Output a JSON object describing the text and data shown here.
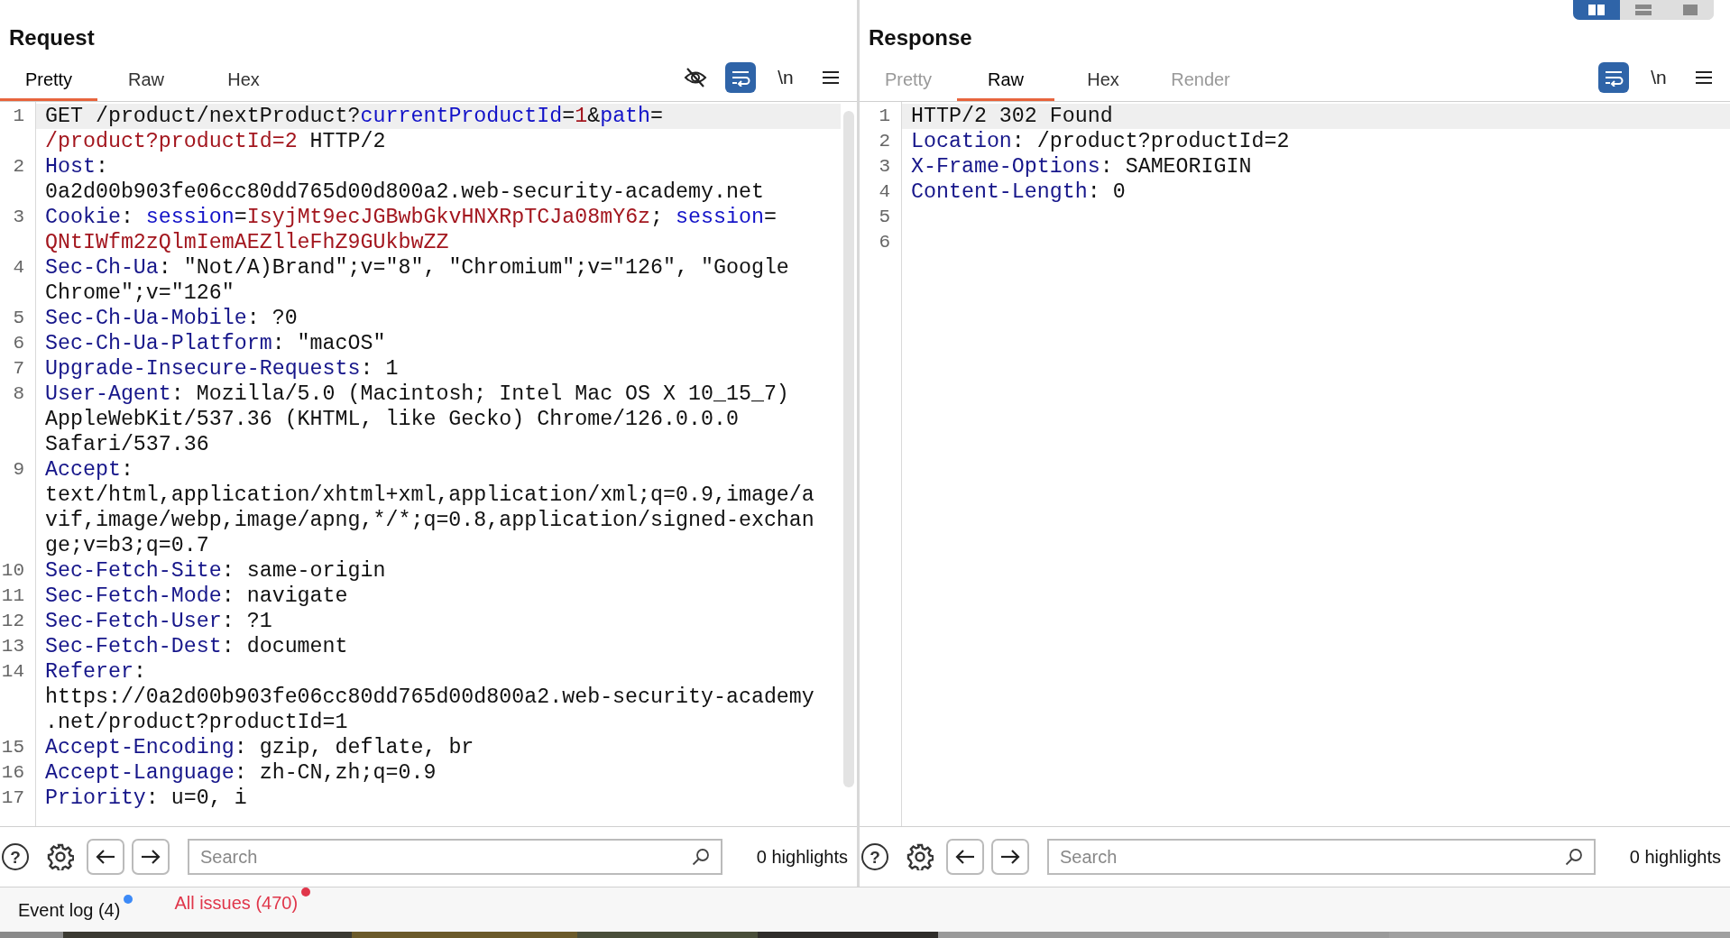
{
  "layout_toggle": [
    {
      "selected": true
    },
    {
      "selected": false
    },
    {
      "selected": false
    }
  ],
  "panes": [
    {
      "title": "Request",
      "tabs": [
        {
          "label": "Pretty",
          "selected": true,
          "disabled": false
        },
        {
          "label": "Raw",
          "selected": false,
          "disabled": false
        },
        {
          "label": "Hex",
          "selected": false,
          "disabled": false
        }
      ],
      "toolbar": [
        {
          "kind": "hide",
          "on": false
        },
        {
          "kind": "wrap",
          "on": true
        },
        {
          "kind": "newline",
          "label": "\\n",
          "on": false
        },
        {
          "kind": "menu",
          "on": false
        }
      ],
      "lines": [
        {
          "number": "1",
          "current": true,
          "rows": [
            [
              {
                "kind": "plain",
                "text": "GET /product/nextProduct?"
              },
              {
                "kind": "param",
                "text": "currentProductId"
              },
              {
                "kind": "plain",
                "text": "="
              },
              {
                "kind": "value",
                "text": "1"
              },
              {
                "kind": "plain",
                "text": "&"
              },
              {
                "kind": "param",
                "text": "path"
              },
              {
                "kind": "plain",
                "text": "="
              }
            ],
            [
              {
                "kind": "value",
                "text": "/product?productId=2"
              },
              {
                "kind": "plain",
                "text": " HTTP/2"
              }
            ]
          ]
        },
        {
          "number": "2",
          "current": false,
          "rows": [
            [
              {
                "kind": "name",
                "text": "Host"
              },
              {
                "kind": "plain",
                "text": ":"
              }
            ],
            [
              {
                "kind": "plain",
                "text": "0a2d00b903fe06cc80dd765d00d800a2.web-security-academy.net"
              }
            ]
          ]
        },
        {
          "number": "3",
          "current": false,
          "rows": [
            [
              {
                "kind": "name",
                "text": "Cookie"
              },
              {
                "kind": "plain",
                "text": ": "
              },
              {
                "kind": "param",
                "text": "session"
              },
              {
                "kind": "plain",
                "text": "="
              },
              {
                "kind": "value",
                "text": "IsyjMt9ecJGBwbGkvHNXRpTCJa08mY6z"
              },
              {
                "kind": "plain",
                "text": "; "
              },
              {
                "kind": "param",
                "text": "session"
              },
              {
                "kind": "plain",
                "text": "="
              }
            ],
            [
              {
                "kind": "value",
                "text": "QNtIWfm2zQlmIemAEZlleFhZ9GUkbwZZ"
              }
            ]
          ]
        },
        {
          "number": "4",
          "current": false,
          "rows": [
            [
              {
                "kind": "name",
                "text": "Sec-Ch-Ua"
              },
              {
                "kind": "plain",
                "text": ": \"Not/A)Brand\";v=\"8\", \"Chromium\";v=\"126\", \"Google"
              }
            ],
            [
              {
                "kind": "plain",
                "text": "Chrome\";v=\"126\""
              }
            ]
          ]
        },
        {
          "number": "5",
          "current": false,
          "rows": [
            [
              {
                "kind": "name",
                "text": "Sec-Ch-Ua-Mobile"
              },
              {
                "kind": "plain",
                "text": ": ?0"
              }
            ]
          ]
        },
        {
          "number": "6",
          "current": false,
          "rows": [
            [
              {
                "kind": "name",
                "text": "Sec-Ch-Ua-Platform"
              },
              {
                "kind": "plain",
                "text": ": \"macOS\""
              }
            ]
          ]
        },
        {
          "number": "7",
          "current": false,
          "rows": [
            [
              {
                "kind": "name",
                "text": "Upgrade-Insecure-Requests"
              },
              {
                "kind": "plain",
                "text": ": 1"
              }
            ]
          ]
        },
        {
          "number": "8",
          "current": false,
          "rows": [
            [
              {
                "kind": "name",
                "text": "User-Agent"
              },
              {
                "kind": "plain",
                "text": ": Mozilla/5.0 (Macintosh; Intel Mac OS X 10_15_7)"
              }
            ],
            [
              {
                "kind": "plain",
                "text": "AppleWebKit/537.36 (KHTML, like Gecko) Chrome/126.0.0.0"
              }
            ],
            [
              {
                "kind": "plain",
                "text": "Safari/537.36"
              }
            ]
          ]
        },
        {
          "number": "9",
          "current": false,
          "rows": [
            [
              {
                "kind": "name",
                "text": "Accept"
              },
              {
                "kind": "plain",
                "text": ":"
              }
            ],
            [
              {
                "kind": "plain",
                "text": "text/html,application/xhtml+xml,application/xml;q=0.9,image/a"
              }
            ],
            [
              {
                "kind": "plain",
                "text": "vif,image/webp,image/apng,*/*;q=0.8,application/signed-exchan"
              }
            ],
            [
              {
                "kind": "plain",
                "text": "ge;v=b3;q=0.7"
              }
            ]
          ]
        },
        {
          "number": "10",
          "current": false,
          "rows": [
            [
              {
                "kind": "name",
                "text": "Sec-Fetch-Site"
              },
              {
                "kind": "plain",
                "text": ": same-origin"
              }
            ]
          ]
        },
        {
          "number": "11",
          "current": false,
          "rows": [
            [
              {
                "kind": "name",
                "text": "Sec-Fetch-Mode"
              },
              {
                "kind": "plain",
                "text": ": navigate"
              }
            ]
          ]
        },
        {
          "number": "12",
          "current": false,
          "rows": [
            [
              {
                "kind": "name",
                "text": "Sec-Fetch-User"
              },
              {
                "kind": "plain",
                "text": ": ?1"
              }
            ]
          ]
        },
        {
          "number": "13",
          "current": false,
          "rows": [
            [
              {
                "kind": "name",
                "text": "Sec-Fetch-Dest"
              },
              {
                "kind": "plain",
                "text": ": document"
              }
            ]
          ]
        },
        {
          "number": "14",
          "current": false,
          "rows": [
            [
              {
                "kind": "name",
                "text": "Referer"
              },
              {
                "kind": "plain",
                "text": ":"
              }
            ],
            [
              {
                "kind": "plain",
                "text": "https://0a2d00b903fe06cc80dd765d00d800a2.web-security-academy"
              }
            ],
            [
              {
                "kind": "plain",
                "text": ".net/product?productId=1"
              }
            ]
          ]
        },
        {
          "number": "15",
          "current": false,
          "rows": [
            [
              {
                "kind": "name",
                "text": "Accept-Encoding"
              },
              {
                "kind": "plain",
                "text": ": gzip, deflate, br"
              }
            ]
          ]
        },
        {
          "number": "16",
          "current": false,
          "rows": [
            [
              {
                "kind": "name",
                "text": "Accept-Language"
              },
              {
                "kind": "plain",
                "text": ": zh-CN,zh;q=0.9"
              }
            ]
          ]
        },
        {
          "number": "17",
          "current": false,
          "rows": [
            [
              {
                "kind": "name",
                "text": "Priority"
              },
              {
                "kind": "plain",
                "text": ": u=0, i"
              }
            ]
          ]
        }
      ],
      "footer": {
        "help": "?",
        "search": {
          "placeholder": "Search"
        },
        "highlights": "0 highlights"
      }
    },
    {
      "title": "Response",
      "tabs": [
        {
          "label": "Pretty",
          "selected": false,
          "disabled": true
        },
        {
          "label": "Raw",
          "selected": true,
          "disabled": false
        },
        {
          "label": "Hex",
          "selected": false,
          "disabled": false
        },
        {
          "label": "Render",
          "selected": false,
          "disabled": true
        }
      ],
      "toolbar": [
        {
          "kind": "wrap",
          "on": true
        },
        {
          "kind": "newline",
          "label": "\\n",
          "on": false
        },
        {
          "kind": "menu",
          "on": false
        }
      ],
      "lines": [
        {
          "number": "1",
          "current": true,
          "rows": [
            [
              {
                "kind": "plain",
                "text": "HTTP/2 302 Found"
              }
            ]
          ]
        },
        {
          "number": "2",
          "current": false,
          "rows": [
            [
              {
                "kind": "name",
                "text": "Location"
              },
              {
                "kind": "plain",
                "text": ": /product?productId=2"
              }
            ]
          ]
        },
        {
          "number": "3",
          "current": false,
          "rows": [
            [
              {
                "kind": "name",
                "text": "X-Frame-Options"
              },
              {
                "kind": "plain",
                "text": ": SAMEORIGIN"
              }
            ]
          ]
        },
        {
          "number": "4",
          "current": false,
          "rows": [
            [
              {
                "kind": "name",
                "text": "Content-Length"
              },
              {
                "kind": "plain",
                "text": ": 0"
              }
            ]
          ]
        },
        {
          "number": "5"
        },
        {
          "number": "6"
        }
      ],
      "footer": {
        "help": "?",
        "search": {
          "placeholder": "Search"
        },
        "highlights": "0 highlights"
      }
    }
  ],
  "status_bar": [
    {
      "label": "Event log (4)",
      "alert": false,
      "color": "#3d8af7"
    },
    {
      "label": "All issues (470)",
      "alert": true,
      "color": "#e0364a"
    }
  ]
}
